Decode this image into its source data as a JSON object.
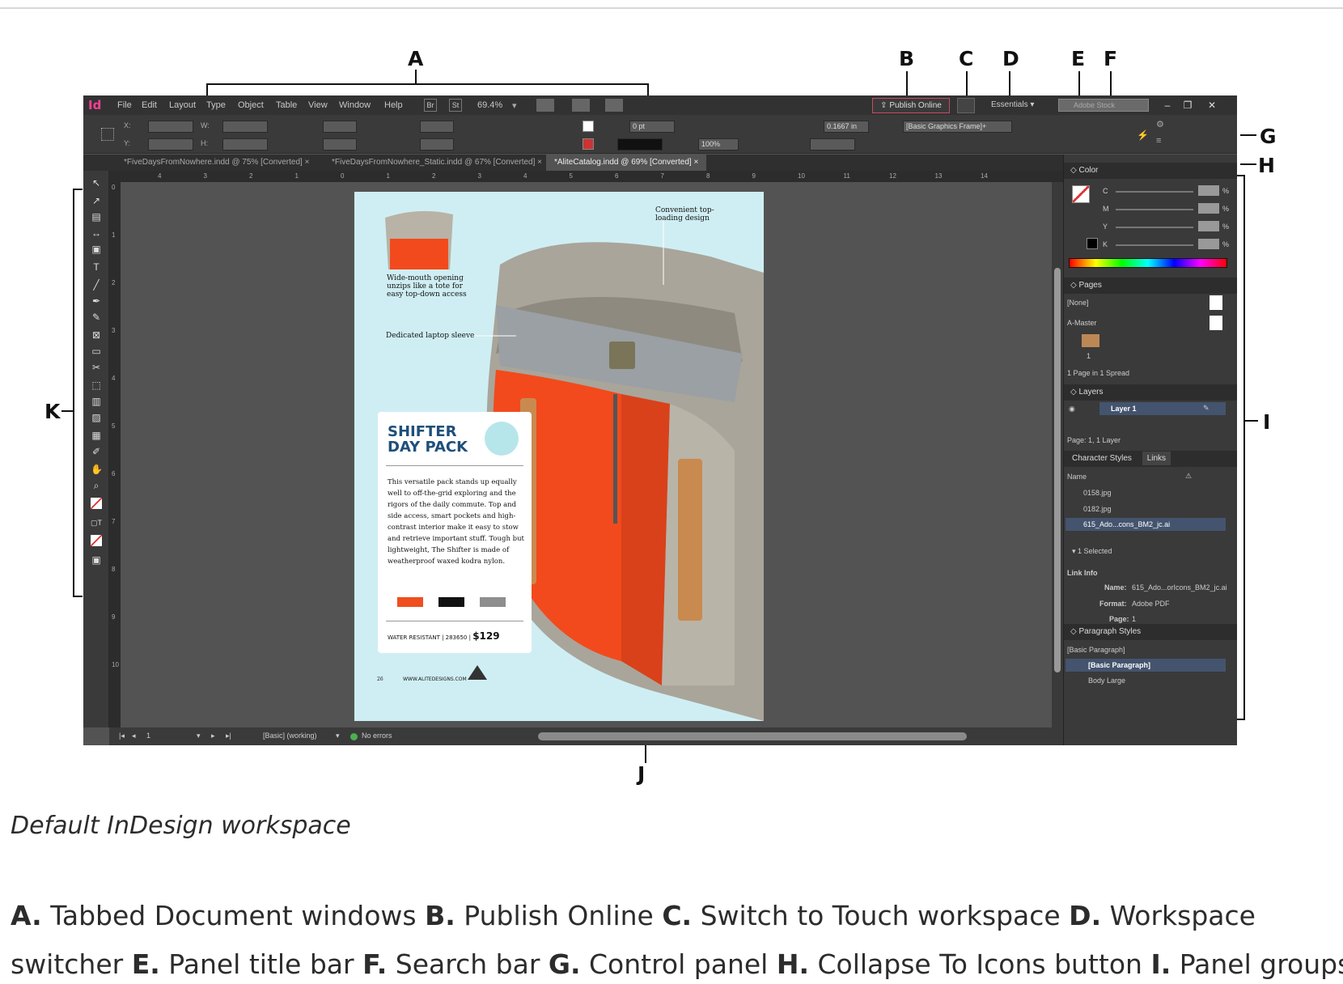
{
  "callouts": {
    "a": "A",
    "b": "B",
    "c": "C",
    "d": "D",
    "e": "E",
    "f": "F",
    "g": "G",
    "h": "H",
    "i": "I",
    "j": "J",
    "k": "K"
  },
  "app": {
    "logo": "Id",
    "menu": [
      "File",
      "Edit",
      "Layout",
      "Type",
      "Object",
      "Table",
      "View",
      "Window",
      "Help"
    ],
    "bridge": "Br",
    "stock_box": "St",
    "zoom": "69.4%",
    "publish_online": "Publish Online",
    "workspace": "Essentials",
    "search_placeholder": "Adobe Stock",
    "win_min": "–",
    "win_restore": "❐",
    "win_close": "✕"
  },
  "control": {
    "x_label": "X:",
    "y_label": "Y:",
    "w_label": "W:",
    "h_label": "H:",
    "stroke_weight": "0 pt",
    "opacity": "100%",
    "offset": "0.1667 in",
    "object_style": "[Basic Graphics Frame]+"
  },
  "tabs": [
    {
      "label": "*FiveDaysFromNowhere.indd @ 75% [Converted]"
    },
    {
      "label": "*FiveDaysFromNowhere_Static.indd @ 67% [Converted]"
    },
    {
      "label": "*AliteCatalog.indd @ 69% [Converted]"
    }
  ],
  "tab_close": "×",
  "ruler_h": [
    "4",
    "3",
    "2",
    "1",
    "0",
    "1",
    "2",
    "3",
    "4",
    "5",
    "6",
    "7",
    "8",
    "9",
    "10",
    "11",
    "12",
    "13",
    "14"
  ],
  "ruler_v": [
    "0",
    "1",
    "2",
    "3",
    "4",
    "5",
    "6",
    "7",
    "8",
    "9",
    "10"
  ],
  "page": {
    "top_callout": "Convenient top-loading design",
    "wide_mouth": "Wide-mouth opening unzips like a tote for easy top-down access",
    "laptop": "Dedicated laptop sleeve",
    "card_title_1": "SHIFTER",
    "card_title_2": "DAY PACK",
    "card_body": "This versatile pack stands up equally well to off-the-grid exploring and the rigors of the daily commute. Top and side access, smart pockets and high-contrast interior make it easy to stow and retrieve important stuff. Tough but lightweight, The Shifter is made of weatherproof waxed kodra nylon.",
    "swatches": [
      {
        "color": "#f04e1f"
      },
      {
        "color": "#111111"
      },
      {
        "color": "#8e8e8e"
      }
    ],
    "foot_text": "WATER RESISTANT | 283650 |",
    "price": "$129",
    "page_number": "26",
    "website": "WWW.ALITEDESIGNS.COM"
  },
  "status": {
    "page_num": "1",
    "preflight_profile": "[Basic] (working)",
    "errors": "No errors"
  },
  "panels": {
    "color": {
      "title": "Color",
      "channels": [
        "C",
        "M",
        "Y",
        "K"
      ],
      "pct": "%"
    },
    "pages": {
      "title": "Pages",
      "none": "[None]",
      "master": "A-Master",
      "page_num": "1",
      "footer": "1 Page in 1 Spread"
    },
    "layers": {
      "title": "Layers",
      "layer1": "Layer 1",
      "footer": "Page: 1, 1 Layer"
    },
    "links": {
      "tab_char": "Character Styles",
      "tab_links": "Links",
      "name_col": "Name",
      "files": [
        "0158.jpg",
        "0182.jpg",
        "615_Ado...cons_BM2_jc.ai"
      ],
      "selected": "1 Selected",
      "link_info": "Link Info",
      "name_label": "Name:",
      "name_val": "615_Ado...orIcons_BM2_jc.ai",
      "format_label": "Format:",
      "format_val": "Adobe PDF",
      "page_label": "Page:",
      "page_val": "1"
    },
    "para": {
      "title": "Paragraph Styles",
      "current": "[Basic Paragraph]",
      "items": [
        "[Basic Paragraph]",
        "Body Large"
      ]
    }
  },
  "caption": "Default InDesign workspace",
  "legend_line1": [
    {
      "letter": "A.",
      "text": " Tabbed Document windows "
    },
    {
      "letter": "B.",
      "text": " Publish Online "
    },
    {
      "letter": "C.",
      "text": " Switch to Touch workspace "
    },
    {
      "letter": "D.",
      "text": " Workspace"
    }
  ],
  "legend_line2": [
    {
      "letter": "",
      "text": "switcher "
    },
    {
      "letter": "E.",
      "text": " Panel title bar "
    },
    {
      "letter": "F.",
      "text": " Search bar "
    },
    {
      "letter": "G.",
      "text": " Control panel "
    },
    {
      "letter": "H.",
      "text": " Collapse To Icons button "
    },
    {
      "letter": "I.",
      "text": " Panel groups"
    }
  ]
}
